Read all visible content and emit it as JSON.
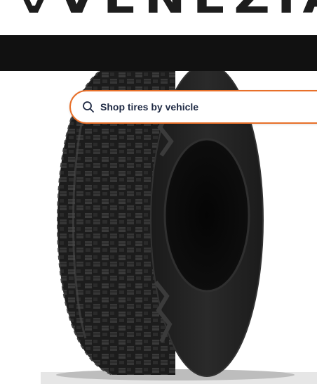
{
  "brand": {
    "name": "VENEZIA"
  },
  "search": {
    "placeholder": "Shop tires by vehicle",
    "icon": "search-icon"
  },
  "hero": {
    "image": "off-road-mud-terrain-tire"
  },
  "colors": {
    "accent": "#e8702a",
    "nav_background": "#111111",
    "text_dark": "#1f2a44",
    "logo": "#1d1d1d"
  }
}
